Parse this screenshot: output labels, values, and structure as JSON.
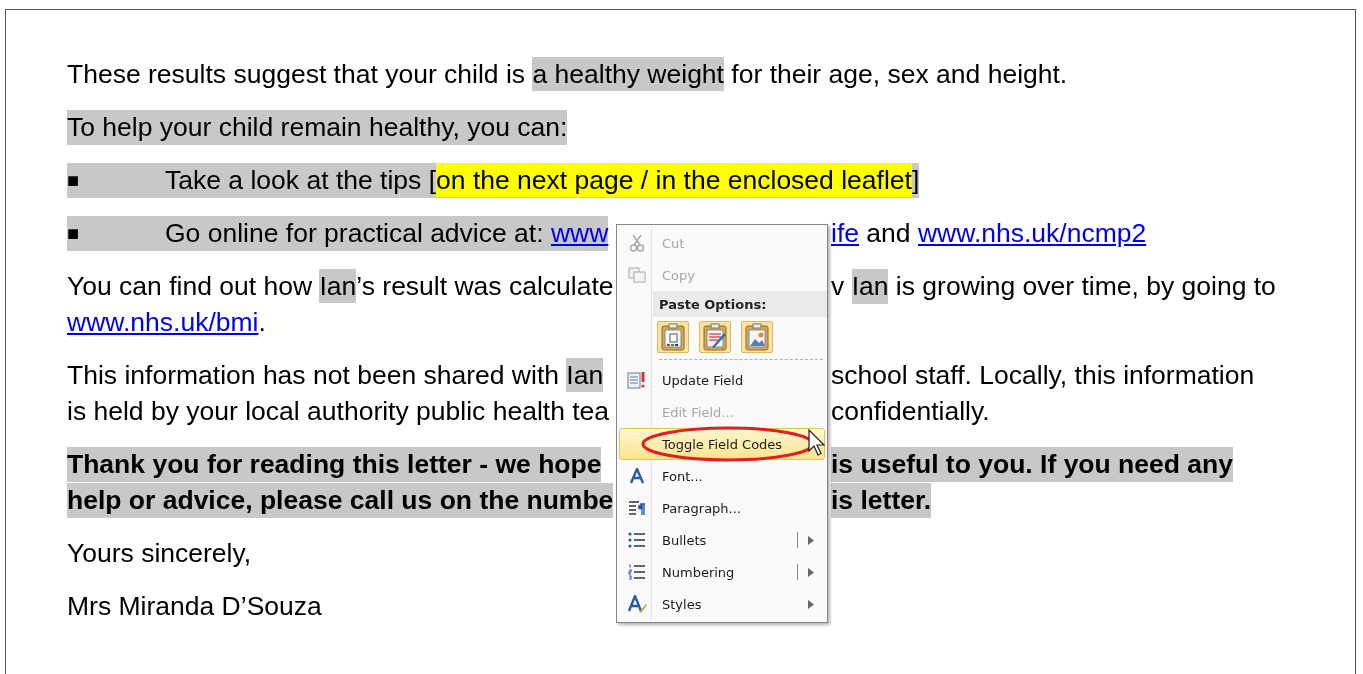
{
  "document": {
    "paragraphs": [
      {
        "bold": false,
        "lines": [
          {
            "shaded": false,
            "segments": [
              {
                "kind": "plain",
                "text": "These results suggest that your child is "
              },
              {
                "kind": "field",
                "text": "a healthy weight"
              },
              {
                "kind": "plain",
                "text": " for their age, sex and height."
              }
            ]
          }
        ]
      },
      {
        "bold": false,
        "lines": [
          {
            "shaded": true,
            "segments": [
              {
                "kind": "plain",
                "text": "To help your child remain healthy, you can:"
              }
            ]
          }
        ]
      },
      {
        "bold": false,
        "lines": [
          {
            "shaded": true,
            "bullet": "■",
            "segments": [
              {
                "kind": "plain",
                "text": "Take a look at the tips ["
              },
              {
                "kind": "marker",
                "text": "on the next page / in the enclosed leaflet"
              },
              {
                "kind": "plain",
                "text": "]"
              }
            ]
          }
        ]
      },
      {
        "bold": false,
        "lines": [
          {
            "shaded": true,
            "bullet": "■",
            "segments": [
              {
                "kind": "plain",
                "text": "Go online for practical advice at: "
              },
              {
                "kind": "link",
                "text": "www"
              }
            ],
            "after_menu": [
              {
                "kind": "link",
                "text": "ife"
              },
              {
                "kind": "plain",
                "text": " and "
              },
              {
                "kind": "link",
                "text": "www.nhs.uk/ncmp2"
              }
            ]
          }
        ]
      },
      {
        "bold": false,
        "lines": [
          {
            "shaded": false,
            "segments": [
              {
                "kind": "plain",
                "text": "You can find out how "
              },
              {
                "kind": "field",
                "text": "Ian"
              },
              {
                "kind": "plain",
                "text": "’s result was calculate"
              }
            ],
            "after_menu": [
              {
                "kind": "plain",
                "text": "v "
              },
              {
                "kind": "field",
                "text": "Ian"
              },
              {
                "kind": "plain",
                "text": " is growing over time, by going to"
              }
            ]
          },
          {
            "shaded": false,
            "segments": [
              {
                "kind": "link",
                "text": "www.nhs.uk/bmi"
              },
              {
                "kind": "plain",
                "text": "."
              }
            ]
          }
        ]
      },
      {
        "bold": false,
        "lines": [
          {
            "shaded": false,
            "segments": [
              {
                "kind": "plain",
                "text": "This information has not been shared with "
              },
              {
                "kind": "field",
                "text": "Ian"
              }
            ],
            "after_menu": [
              {
                "kind": "plain",
                "text": "school staff. Locally, this information"
              }
            ]
          },
          {
            "shaded": false,
            "segments": [
              {
                "kind": "plain",
                "text": "is held by your local authority public health tea"
              }
            ],
            "after_menu": [
              {
                "kind": "plain",
                "text": "confidentially."
              }
            ]
          }
        ]
      },
      {
        "bold": true,
        "lines": [
          {
            "shaded": true,
            "segments": [
              {
                "kind": "plain",
                "text": "Thank you for reading this letter - we hope"
              }
            ],
            "after_menu": [
              {
                "kind": "plain",
                "text": "is useful to you. If you need any"
              }
            ]
          },
          {
            "shaded": true,
            "segments": [
              {
                "kind": "plain",
                "text": "help or advice, please call us on the numbe"
              }
            ],
            "after_menu": [
              {
                "kind": "plain",
                "text": "is letter."
              }
            ]
          }
        ]
      },
      {
        "bold": false,
        "lines": [
          {
            "shaded": false,
            "segments": [
              {
                "kind": "plain",
                "text": "Yours sincerely,"
              }
            ]
          }
        ]
      },
      {
        "bold": false,
        "lines": [
          {
            "shaded": false,
            "segments": [
              {
                "kind": "plain",
                "text": "Mrs Miranda D’Souza"
              }
            ]
          }
        ]
      }
    ]
  },
  "context_menu": {
    "items": [
      {
        "kind": "command",
        "label": "Cut",
        "disabled": true,
        "selected": false,
        "submenu": false,
        "circled": false
      },
      {
        "kind": "command",
        "label": "Copy",
        "disabled": true,
        "selected": false,
        "submenu": false,
        "circled": false
      },
      {
        "kind": "header",
        "label": "Paste Options:"
      },
      {
        "kind": "paste_row"
      },
      {
        "kind": "command",
        "label": "Update Field",
        "disabled": false,
        "selected": false,
        "submenu": false,
        "circled": false
      },
      {
        "kind": "command",
        "label": "Edit Field...",
        "disabled": true,
        "selected": false,
        "submenu": false,
        "circled": false
      },
      {
        "kind": "command",
        "label": "Toggle Field Codes",
        "disabled": false,
        "selected": true,
        "submenu": false,
        "circled": true
      },
      {
        "kind": "command",
        "label": "Font...",
        "disabled": false,
        "selected": false,
        "submenu": false,
        "circled": false
      },
      {
        "kind": "command",
        "label": "Paragraph...",
        "disabled": false,
        "selected": false,
        "submenu": false,
        "circled": false
      },
      {
        "kind": "command",
        "label": "Bullets",
        "disabled": false,
        "selected": false,
        "submenu": true,
        "split": true,
        "circled": false
      },
      {
        "kind": "command",
        "label": "Numbering",
        "disabled": false,
        "selected": false,
        "submenu": true,
        "split": true,
        "circled": false
      },
      {
        "kind": "command",
        "label": "Styles",
        "disabled": false,
        "selected": false,
        "submenu": true,
        "split": false,
        "circled": false
      }
    ]
  }
}
